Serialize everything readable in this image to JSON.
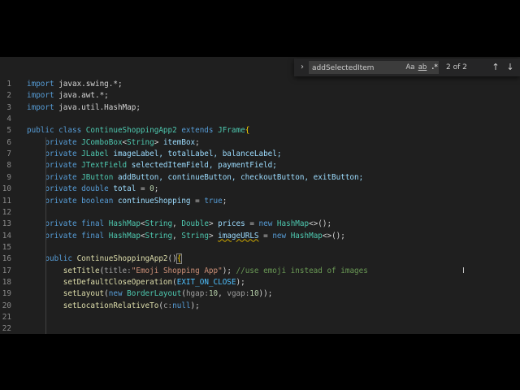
{
  "find": {
    "toggle_icon": "chevron-right-icon",
    "query": "addSelectedItem",
    "match_case_label": "Aa",
    "whole_word_label": "ab",
    "regex_label": ".*",
    "count": "2 of 2",
    "prev_icon": "arrow-up-icon",
    "next_icon": "arrow-down-icon"
  },
  "editor": {
    "lines": [
      {
        "n": "1",
        "tokens": [
          {
            "t": "import",
            "c": "kw"
          },
          {
            "t": " javax.swing.*;",
            "c": "punct"
          }
        ]
      },
      {
        "n": "2",
        "tokens": [
          {
            "t": "import",
            "c": "kw"
          },
          {
            "t": " java.awt.*;",
            "c": "punct"
          }
        ]
      },
      {
        "n": "3",
        "tokens": [
          {
            "t": "import",
            "c": "kw"
          },
          {
            "t": " java.util.HashMap;",
            "c": "punct"
          }
        ]
      },
      {
        "n": "4",
        "tokens": []
      },
      {
        "n": "5",
        "tokens": [
          {
            "t": "public class ",
            "c": "kw"
          },
          {
            "t": "ContinueShoppingApp2",
            "c": "type"
          },
          {
            "t": " extends ",
            "c": "kw"
          },
          {
            "t": "JFrame",
            "c": "type"
          },
          {
            "t": "{",
            "c": "brace"
          }
        ]
      },
      {
        "n": "6",
        "tokens": [
          {
            "t": "    private ",
            "c": "kw"
          },
          {
            "t": "JComboBox",
            "c": "type"
          },
          {
            "t": "<",
            "c": "punct"
          },
          {
            "t": "String",
            "c": "type"
          },
          {
            "t": "> ",
            "c": "punct"
          },
          {
            "t": "itemBox",
            "c": "var"
          },
          {
            "t": ";",
            "c": "punct"
          }
        ]
      },
      {
        "n": "7",
        "tokens": [
          {
            "t": "    private ",
            "c": "kw"
          },
          {
            "t": "JLabel",
            "c": "type"
          },
          {
            "t": " imageLabel, totalLabel, balanceLabel;",
            "c": "var"
          }
        ]
      },
      {
        "n": "8",
        "tokens": [
          {
            "t": "    private ",
            "c": "kw"
          },
          {
            "t": "JTextField",
            "c": "type"
          },
          {
            "t": " selectedItemField, paymentField;",
            "c": "var"
          }
        ]
      },
      {
        "n": "9",
        "tokens": [
          {
            "t": "    private ",
            "c": "kw"
          },
          {
            "t": "JButton",
            "c": "type"
          },
          {
            "t": " addButton, continueButton, checkoutButton, exitButton;",
            "c": "var"
          }
        ]
      },
      {
        "n": "10",
        "tokens": [
          {
            "t": "    private double ",
            "c": "kw"
          },
          {
            "t": "total",
            "c": "var"
          },
          {
            "t": " = ",
            "c": "punct"
          },
          {
            "t": "0",
            "c": "num"
          },
          {
            "t": ";",
            "c": "punct"
          }
        ]
      },
      {
        "n": "11",
        "tokens": [
          {
            "t": "    private boolean ",
            "c": "kw"
          },
          {
            "t": "continueShopping",
            "c": "var"
          },
          {
            "t": " = ",
            "c": "punct"
          },
          {
            "t": "true",
            "c": "kw"
          },
          {
            "t": ";",
            "c": "punct"
          }
        ]
      },
      {
        "n": "12",
        "tokens": []
      },
      {
        "n": "13",
        "tokens": [
          {
            "t": "    private final ",
            "c": "kw"
          },
          {
            "t": "HashMap",
            "c": "type"
          },
          {
            "t": "<",
            "c": "punct"
          },
          {
            "t": "String",
            "c": "type"
          },
          {
            "t": ", ",
            "c": "punct"
          },
          {
            "t": "Double",
            "c": "type"
          },
          {
            "t": "> ",
            "c": "punct"
          },
          {
            "t": "prices",
            "c": "var"
          },
          {
            "t": " = ",
            "c": "punct"
          },
          {
            "t": "new ",
            "c": "kw"
          },
          {
            "t": "HashMap",
            "c": "type"
          },
          {
            "t": "<>();",
            "c": "punct"
          }
        ]
      },
      {
        "n": "14",
        "tokens": [
          {
            "t": "    private final ",
            "c": "kw"
          },
          {
            "t": "HashMap",
            "c": "type"
          },
          {
            "t": "<",
            "c": "punct"
          },
          {
            "t": "String",
            "c": "type"
          },
          {
            "t": ", ",
            "c": "punct"
          },
          {
            "t": "String",
            "c": "type"
          },
          {
            "t": "> ",
            "c": "punct"
          },
          {
            "t": "imageURLS",
            "c": "var warn"
          },
          {
            "t": " = ",
            "c": "punct"
          },
          {
            "t": "new ",
            "c": "kw"
          },
          {
            "t": "HashMap",
            "c": "type"
          },
          {
            "t": "<>();",
            "c": "punct"
          }
        ]
      },
      {
        "n": "15",
        "tokens": []
      },
      {
        "n": "16",
        "tokens": [
          {
            "t": "    public ",
            "c": "kw"
          },
          {
            "t": "ContinueShoppingApp2",
            "c": "fn"
          },
          {
            "t": "()",
            "c": "punct"
          },
          {
            "t": "{",
            "c": "brace bracket-hl"
          }
        ]
      },
      {
        "n": "17",
        "tokens": [
          {
            "t": "        ",
            "c": "punct"
          },
          {
            "t": "setTitle",
            "c": "fn"
          },
          {
            "t": "(",
            "c": "punct"
          },
          {
            "t": "title:",
            "c": "param"
          },
          {
            "t": "\"Emoji Shopping App\"",
            "c": "str"
          },
          {
            "t": "); ",
            "c": "punct"
          },
          {
            "t": "//use emoji instead of images",
            "c": "comment"
          }
        ]
      },
      {
        "n": "18",
        "tokens": [
          {
            "t": "        ",
            "c": "punct"
          },
          {
            "t": "setDefaultCloseOperation",
            "c": "fn"
          },
          {
            "t": "(",
            "c": "punct"
          },
          {
            "t": "EXIT_ON_CLOSE",
            "c": "const"
          },
          {
            "t": ");",
            "c": "punct"
          }
        ]
      },
      {
        "n": "19",
        "tokens": [
          {
            "t": "        ",
            "c": "punct"
          },
          {
            "t": "setLayout",
            "c": "fn"
          },
          {
            "t": "(",
            "c": "punct"
          },
          {
            "t": "new ",
            "c": "kw"
          },
          {
            "t": "BorderLayout",
            "c": "type"
          },
          {
            "t": "(",
            "c": "punct"
          },
          {
            "t": "hgap:",
            "c": "param"
          },
          {
            "t": "10",
            "c": "num"
          },
          {
            "t": ", ",
            "c": "punct"
          },
          {
            "t": "vgap:",
            "c": "param"
          },
          {
            "t": "10",
            "c": "num"
          },
          {
            "t": "));",
            "c": "punct"
          }
        ]
      },
      {
        "n": "20",
        "tokens": [
          {
            "t": "        ",
            "c": "punct"
          },
          {
            "t": "setLocationRelativeTo",
            "c": "fn"
          },
          {
            "t": "(",
            "c": "punct"
          },
          {
            "t": "c:",
            "c": "param"
          },
          {
            "t": "null",
            "c": "kw"
          },
          {
            "t": ");",
            "c": "punct"
          }
        ]
      },
      {
        "n": "21",
        "tokens": []
      },
      {
        "n": "22",
        "tokens": []
      }
    ]
  }
}
